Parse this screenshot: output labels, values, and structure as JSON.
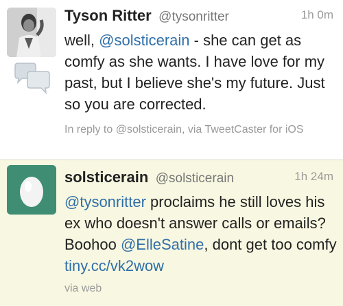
{
  "tweets": [
    {
      "display_name": "Tyson Ritter",
      "handle": "@tysonritter",
      "time": "1h 0m",
      "text_parts": {
        "p1": "well, ",
        "m1": "@solsticerain",
        "p2": " - she can get as comfy as she wants. I have love for my past, but I believe she's my future. Just so you are corrected."
      },
      "meta": "In reply to @solsticerain, via TweetCaster for iOS",
      "avatar_icon": "profile-photo",
      "reply_icon": "conversation-bubbles-icon"
    },
    {
      "display_name": "solsticerain",
      "handle": "@solsticerain",
      "time": "1h 24m",
      "text_parts": {
        "m1": "@tysonritter",
        "p1": " proclaims he still loves his ex who doesn't answer calls or emails? Boohoo ",
        "m2": "@ElleSatine",
        "p2": ", dont get too comfy ",
        "l1": "tiny.cc/vk2wow"
      },
      "meta": "via web",
      "avatar_icon": "default-egg-avatar"
    }
  ],
  "colors": {
    "link": "#2f6fa8",
    "highlight_bg": "#f8f7e1",
    "egg_bg": "#3f8e74"
  }
}
